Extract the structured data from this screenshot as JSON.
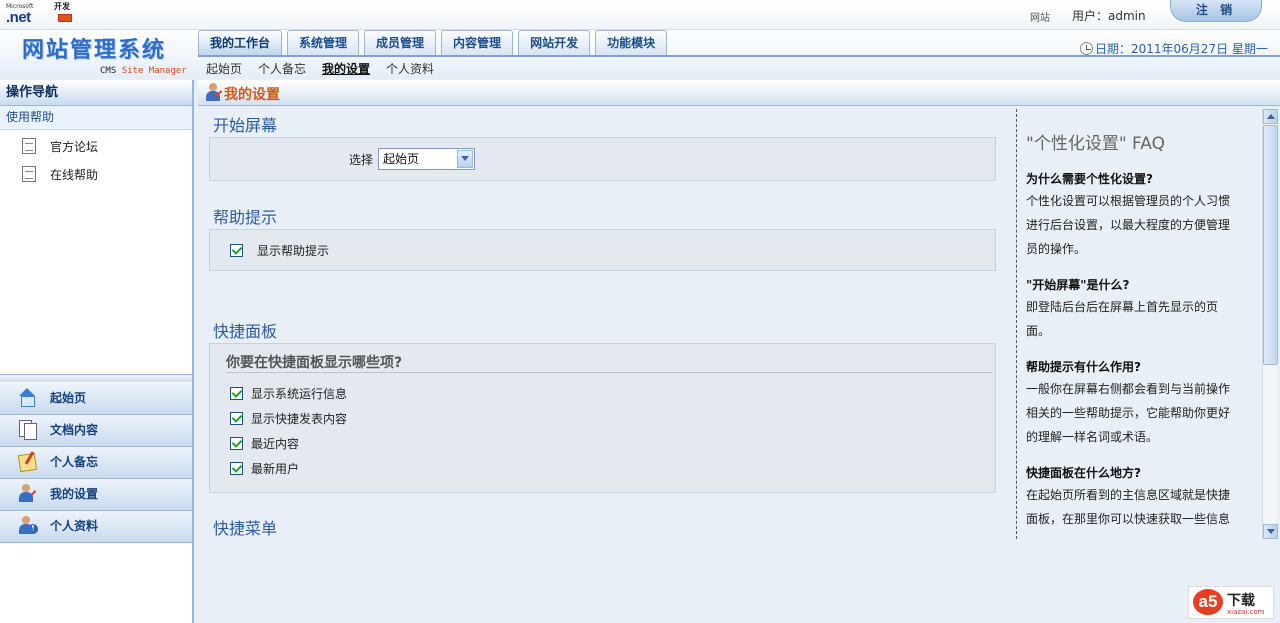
{
  "topbar": {
    "ms_small": "Microsoft",
    "ms_net": ".net",
    "dev_label": "开发",
    "site_link": "网站",
    "user_label": "用户：admin",
    "logout": "注 销"
  },
  "header": {
    "brand": "网站管理系统",
    "brand_cms": "CMS",
    "brand_sub": "Site Manager",
    "date": "日期：2011年06月27日 星期一",
    "main_tabs": [
      "我的工作台",
      "系统管理",
      "成员管理",
      "内容管理",
      "网站开发",
      "功能模块"
    ],
    "active_tab": 0,
    "sub_tabs": [
      "起始页",
      "个人备忘",
      "我的设置",
      "个人资料"
    ],
    "active_sub_tab": 2
  },
  "sidebar": {
    "title": "操作导航",
    "group": "使用帮助",
    "links": [
      "官方论坛",
      "在线帮助"
    ],
    "nav": [
      {
        "label": "起始页",
        "icon": "home-icon"
      },
      {
        "label": "文档内容",
        "icon": "document-icon"
      },
      {
        "label": "个人备忘",
        "icon": "memo-icon"
      },
      {
        "label": "我的设置",
        "icon": "user-settings-icon"
      },
      {
        "label": "个人资料",
        "icon": "user-info-icon"
      }
    ]
  },
  "page": {
    "title": "我的设置",
    "start_screen": {
      "title": "开始屏幕",
      "select_label": "选择",
      "select_value": "起始页"
    },
    "help_tips": {
      "title": "帮助提示",
      "option": "显示帮助提示",
      "checked": true
    },
    "quick_panel": {
      "title": "快捷面板",
      "question": "你要在快捷面板显示哪些项?",
      "options": [
        "显示系统运行信息",
        "显示快捷发表内容",
        "最近内容",
        "最新用户"
      ]
    },
    "quick_menu": {
      "title": "快捷菜单"
    }
  },
  "faq": {
    "title": "\"个性化设置\" FAQ",
    "items": [
      {
        "q": "为什么需要个性化设置?",
        "a": "个性化设置可以根据管理员的个人习惯进行后台设置，以最大程度的方便管理员的操作。"
      },
      {
        "q": "\"开始屏幕\"是什么?",
        "a": "即登陆后台后在屏幕上首先显示的页面。"
      },
      {
        "q": "帮助提示有什么作用?",
        "a": "一般你在屏幕右侧都会看到与当前操作相关的一些帮助提示，它能帮助你更好的理解一样名词或术语。"
      },
      {
        "q": "快捷面板在什么地方?",
        "a": "在起始页所看到的主信息区域就是快捷面板，在那里你可以快速获取一些信息"
      }
    ]
  },
  "watermark": {
    "logo": "a5",
    "text": "下载",
    "url": "xiazai.com"
  }
}
